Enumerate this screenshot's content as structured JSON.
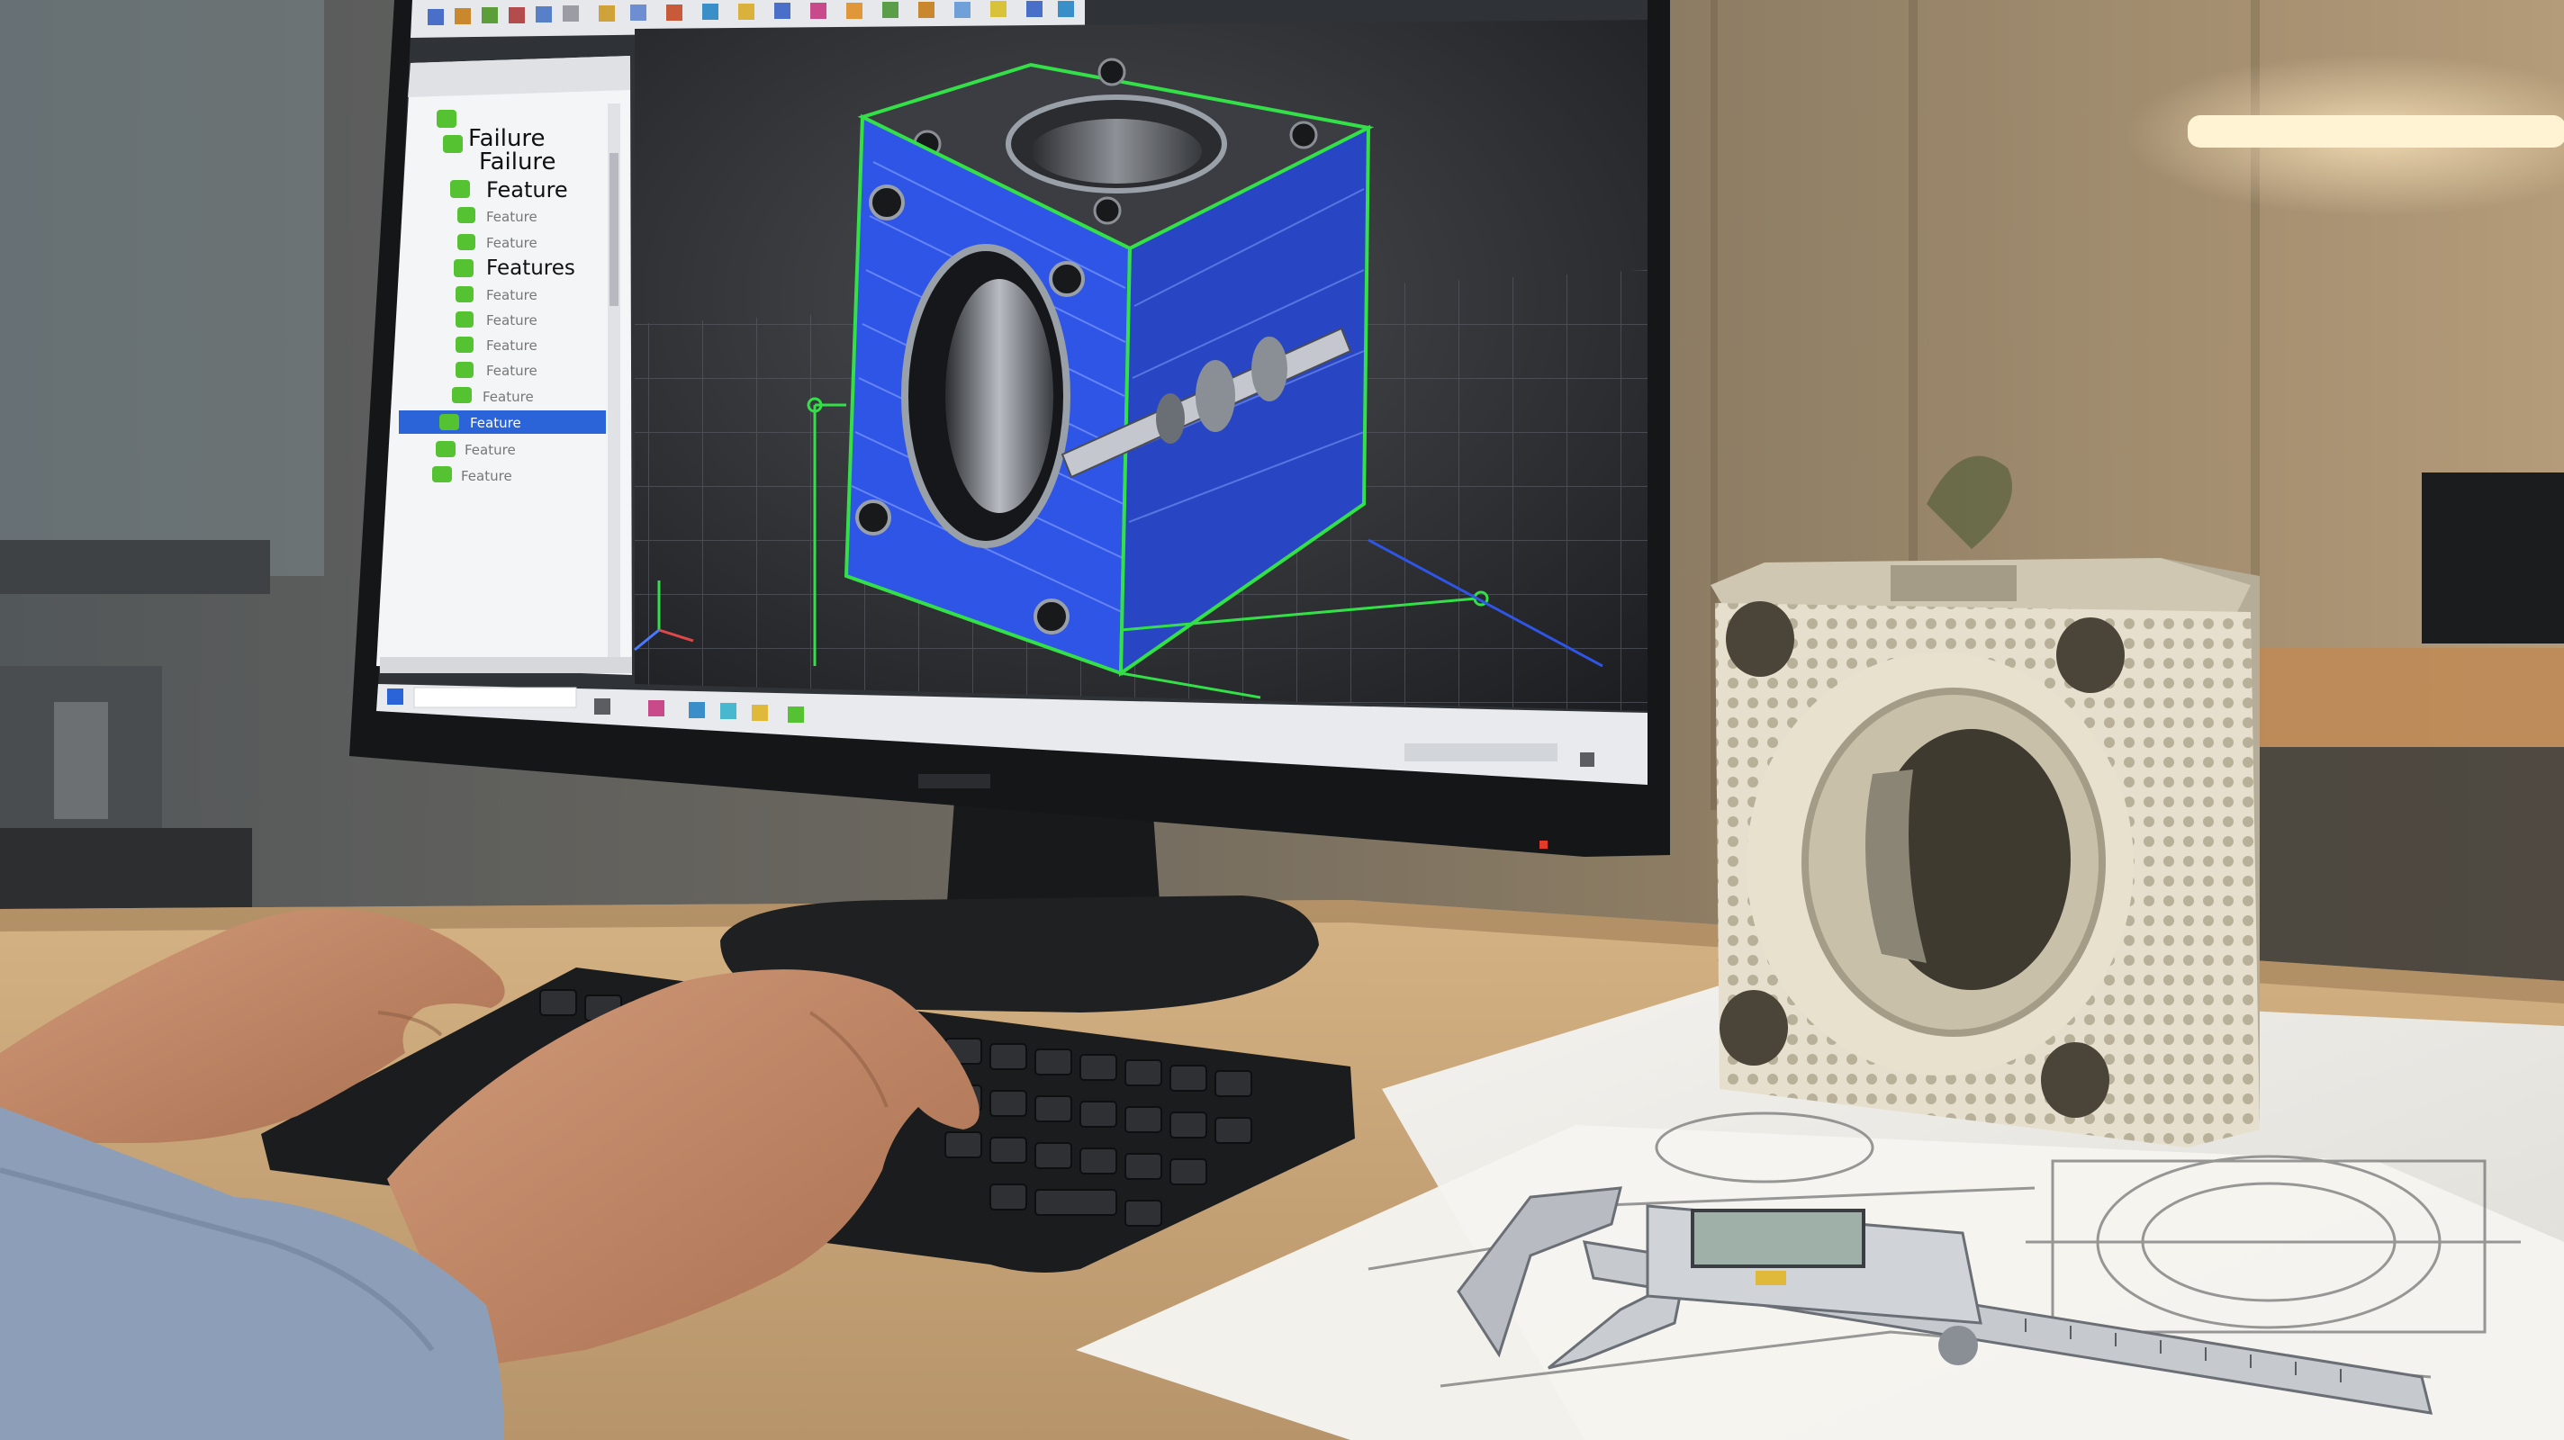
{
  "cad_app": {
    "tree_items": [
      {
        "label": "Failure",
        "selected": false
      },
      {
        "label": "Failure",
        "selected": false
      },
      {
        "label": "Feature",
        "selected": false
      },
      {
        "label": "Feature",
        "selected": false
      },
      {
        "label": "Feature",
        "selected": false
      },
      {
        "label": "Features",
        "selected": false
      },
      {
        "label": "Feature",
        "selected": false
      },
      {
        "label": "Feature",
        "selected": false
      },
      {
        "label": "Feature",
        "selected": false
      },
      {
        "label": "Feature",
        "selected": false
      },
      {
        "label": "Feature",
        "selected": false
      },
      {
        "label": "Feature",
        "selected": true
      },
      {
        "label": "Feature",
        "selected": false
      },
      {
        "label": "Feature",
        "selected": false
      }
    ]
  },
  "colors": {
    "wireframe_green": "#33e048",
    "mesh_blue": "#2f55e6",
    "selection_blue": "#2b63d8",
    "tree_node_green": "#55c232",
    "printed_part": "#ddd6c4",
    "desk_wood": "#c9a271"
  },
  "icons": [
    "tree-node-icon",
    "windows-start-icon",
    "taskbar-app-icon",
    "axis-triad-icon"
  ]
}
